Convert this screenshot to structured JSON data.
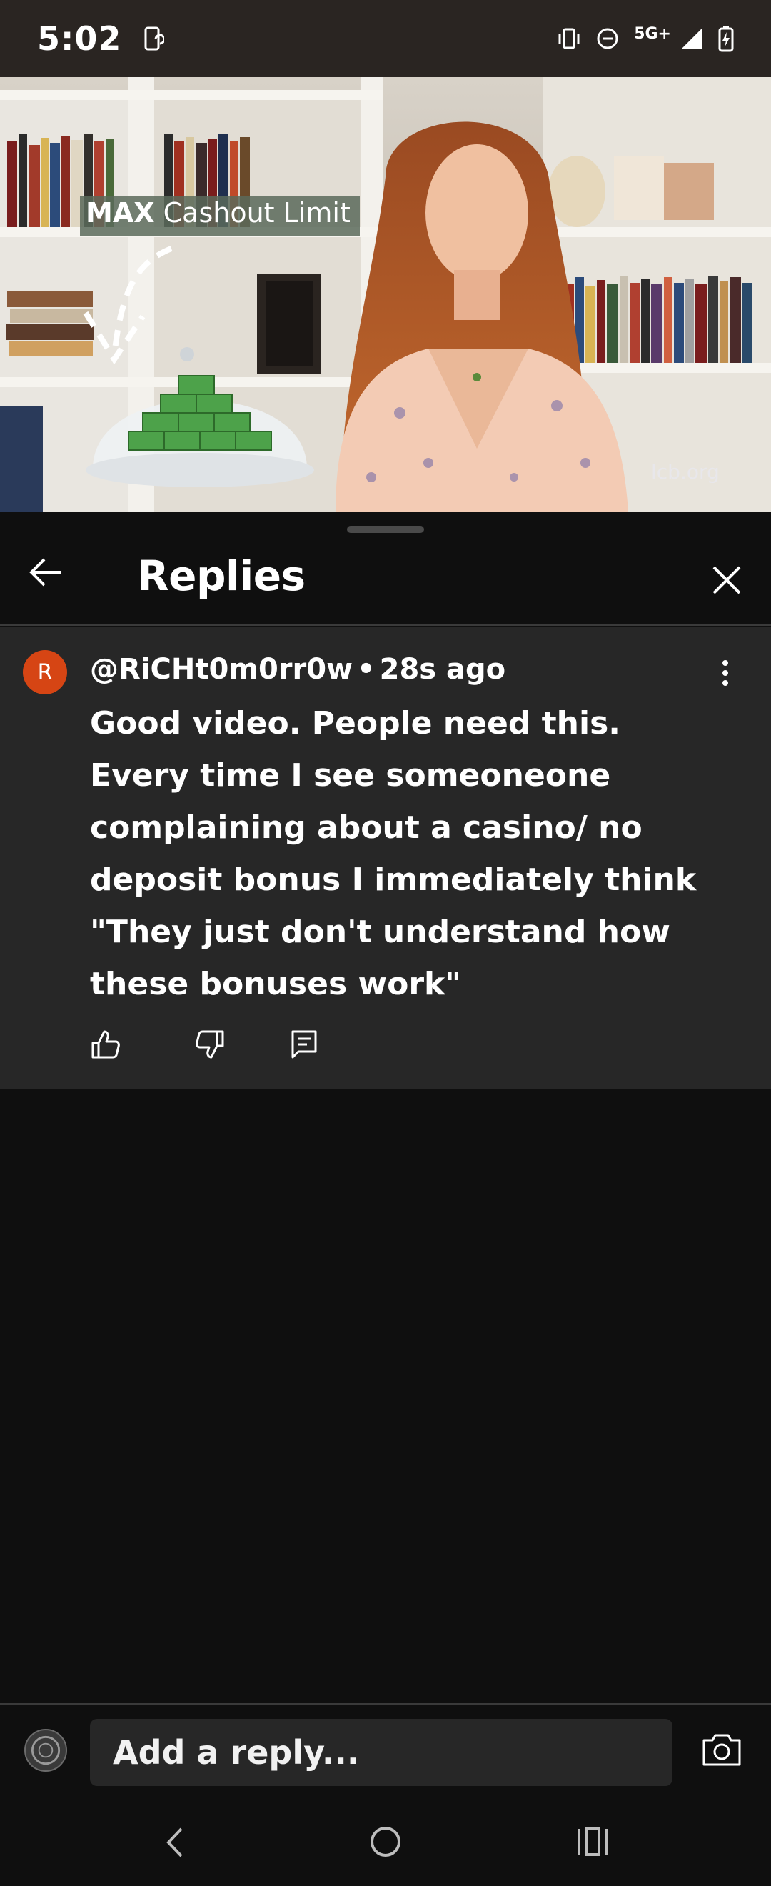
{
  "status_bar": {
    "time": "5:02",
    "network": "5G+",
    "icons": [
      "screen-rotate-icon",
      "vibrate-icon",
      "do-not-disturb-icon",
      "signal-icon",
      "battery-charging-icon"
    ]
  },
  "video": {
    "overlay_bold": "MAX",
    "overlay_text": "Cashout Limit",
    "watermark": "lcb.org"
  },
  "header": {
    "title": "Replies",
    "back_icon": "arrow-left-icon",
    "close_icon": "close-icon"
  },
  "comment": {
    "avatar_letter": "R",
    "avatar_color": "#d64514",
    "author": "@RiCHt0m0rr0w",
    "separator": "•",
    "time_ago": "28s ago",
    "text_lines": [
      "Good video. People need this.",
      "Every time I see someoneone",
      "complaining about a casino/ no",
      "deposit bonus I immediately think",
      "\"They just don't understand how",
      "these bonuses work\""
    ],
    "actions": [
      "thumbs-up-icon",
      "thumbs-down-icon",
      "reply-icon"
    ]
  },
  "reply_bar": {
    "placeholder": "Add a reply..."
  },
  "nav": {
    "icons": [
      "nav-back-icon",
      "nav-home-icon",
      "nav-recents-icon"
    ]
  }
}
